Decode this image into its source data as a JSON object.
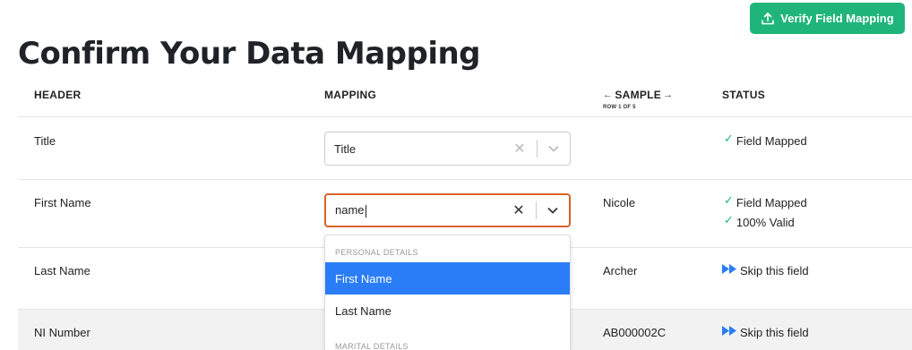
{
  "toolbar": {
    "verify_label": "Verify Field Mapping",
    "verify_icon": "upload-icon",
    "accent": "#1fb57a"
  },
  "page": {
    "title": "Confirm Your Data Mapping"
  },
  "table": {
    "columns": {
      "header": "HEADER",
      "mapping": "MAPPING",
      "sample": "SAMPLE",
      "status": "STATUS"
    },
    "sample_nav": {
      "prev": "←",
      "next": "→",
      "indicator": "ROW 1 OF 5"
    },
    "rows": [
      {
        "header": "Title",
        "mapping": "Title",
        "sample": "",
        "status": [
          "Field Mapped"
        ]
      },
      {
        "header": "First Name",
        "mapping": "name",
        "sample": "Nicole",
        "status": [
          "Field Mapped",
          "100% Valid"
        ]
      },
      {
        "header": "Last Name",
        "sample": "Archer",
        "status": [
          "Skip this field"
        ]
      },
      {
        "header": "NI Number",
        "sample": "AB000002C",
        "status": [
          "Skip this field"
        ]
      }
    ]
  },
  "dropdown": {
    "groups": [
      {
        "label": "PERSONAL DETAILS",
        "options": [
          "First Name",
          "Last Name"
        ]
      },
      {
        "label": "MARITAL DETAILS",
        "options": []
      }
    ],
    "highlighted": "First Name",
    "highlight_color": "#2a7df7",
    "focus_color": "#d9622b"
  },
  "icons": {
    "check": "✓",
    "clear": "✕"
  }
}
